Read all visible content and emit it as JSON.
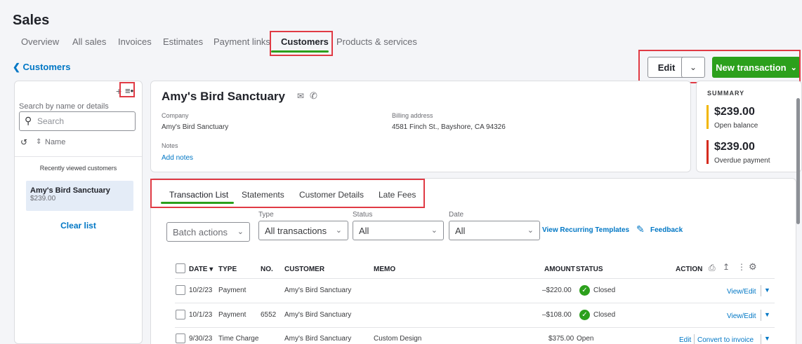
{
  "page": {
    "title": "Sales"
  },
  "tabs": [
    "Overview",
    "All sales",
    "Invoices",
    "Estimates",
    "Payment links",
    "Customers",
    "Products & services"
  ],
  "back": {
    "label": "Customers"
  },
  "toolbar": {
    "edit": "Edit",
    "new_transaction": "New transaction"
  },
  "sidebar": {
    "search_label": "Search by name or details",
    "search_placeholder": "Search",
    "sort_label": "Name",
    "recent_label": "Recently viewed customers",
    "recent": {
      "name": "Amy's Bird Sanctuary",
      "amount": "$239.00"
    },
    "clear": "Clear list"
  },
  "customer": {
    "name": "Amy's Bird Sanctuary",
    "company_label": "Company",
    "company": "Amy's Bird Sanctuary",
    "billing_label": "Billing address",
    "billing": "4581 Finch St., Bayshore, CA 94326",
    "notes_label": "Notes",
    "add_notes": "Add notes"
  },
  "summary": {
    "title": "SUMMARY",
    "open_amount": "$239.00",
    "open_label": "Open balance",
    "overdue_amount": "$239.00",
    "overdue_label": "Overdue payment",
    "open_color": "#f2b600",
    "overdue_color": "#d52b1e"
  },
  "subtabs": [
    "Transaction List",
    "Statements",
    "Customer Details",
    "Late Fees"
  ],
  "filters": {
    "batch": "Batch actions",
    "type_label": "Type",
    "type_value": "All transactions",
    "status_label": "Status",
    "status_value": "All",
    "date_label": "Date",
    "date_value": "All",
    "recurring": "View Recurring Templates",
    "feedback": "Feedback"
  },
  "table": {
    "headers": {
      "date": "DATE ▾",
      "type": "TYPE",
      "no": "NO.",
      "customer": "CUSTOMER",
      "memo": "MEMO",
      "amount": "AMOUNT",
      "status": "STATUS",
      "action": "ACTION"
    },
    "rows": [
      {
        "date": "10/2/23",
        "type": "Payment",
        "no": "",
        "customer": "Amy's Bird Sanctuary",
        "memo": "",
        "amount": "–$220.00",
        "status": "Closed",
        "action": "View/Edit"
      },
      {
        "date": "10/1/23",
        "type": "Payment",
        "no": "6552",
        "customer": "Amy's Bird Sanctuary",
        "memo": "",
        "amount": "–$108.00",
        "status": "Closed",
        "action": "View/Edit"
      },
      {
        "date": "9/30/23",
        "type": "Time Charge",
        "no": "",
        "customer": "Amy's Bird Sanctuary",
        "memo": "Custom Design",
        "amount": "$375.00",
        "status": "Open",
        "action_edit": "Edit",
        "action": "Convert to invoice"
      }
    ]
  }
}
